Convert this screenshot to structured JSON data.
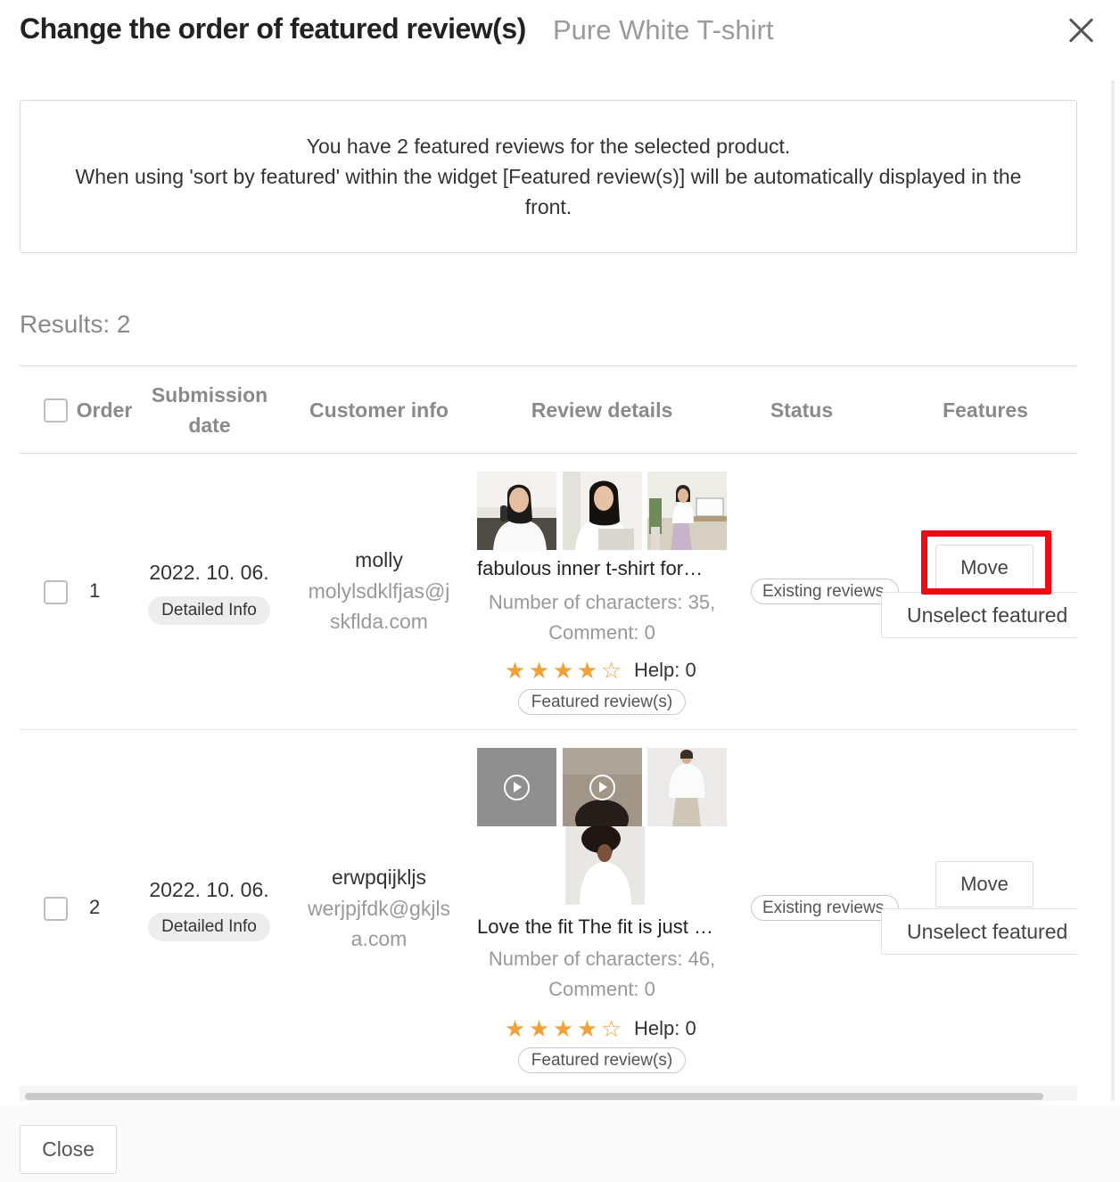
{
  "header": {
    "title": "Change the order of featured review(s)",
    "product_name": "Pure White T-shirt",
    "close_icon": "close-icon"
  },
  "notice": {
    "line1": "You have 2 featured reviews for the selected product.",
    "line2": "When using 'sort by featured' within the widget [Featured review(s)] will be automatically displayed in the front."
  },
  "results_label": "Results: 2",
  "table": {
    "columns": {
      "order": "Order",
      "submission_date": "Submission date",
      "customer_info": "Customer info",
      "review_details": "Review details",
      "status": "Status",
      "features": "Features"
    },
    "rows": [
      {
        "order": "1",
        "date": "2022. 10. 06.",
        "detail_label": "Detailed Info",
        "customer_name": "molly",
        "customer_email": "molylsdklfjas@jskflda.com",
        "review_title": "fabulous inner t-shirt for…",
        "review_meta": "Number of characters: 35, Comment: 0",
        "rating": 4,
        "rating_max": 5,
        "help": "Help: 0",
        "featured_label": "Featured review(s)",
        "status": "Existing reviews",
        "move_label": "Move",
        "unselect_label": "Unselect featured"
      },
      {
        "order": "2",
        "date": "2022. 10. 06.",
        "detail_label": "Detailed Info",
        "customer_name": "erwpqijkljs",
        "customer_email": "werjpjfdk@gkjlsa.com",
        "review_title": "Love the fit The fit is just …",
        "review_meta": "Number of characters: 46, Comment: 0",
        "rating": 4,
        "rating_max": 5,
        "help": "Help: 0",
        "featured_label": "Featured review(s)",
        "status": "Existing reviews",
        "move_label": "Move",
        "unselect_label": "Unselect featured"
      }
    ]
  },
  "footer": {
    "close_label": "Close"
  },
  "colors": {
    "highlight": "#ec0c15",
    "star": "#f0a23a"
  }
}
